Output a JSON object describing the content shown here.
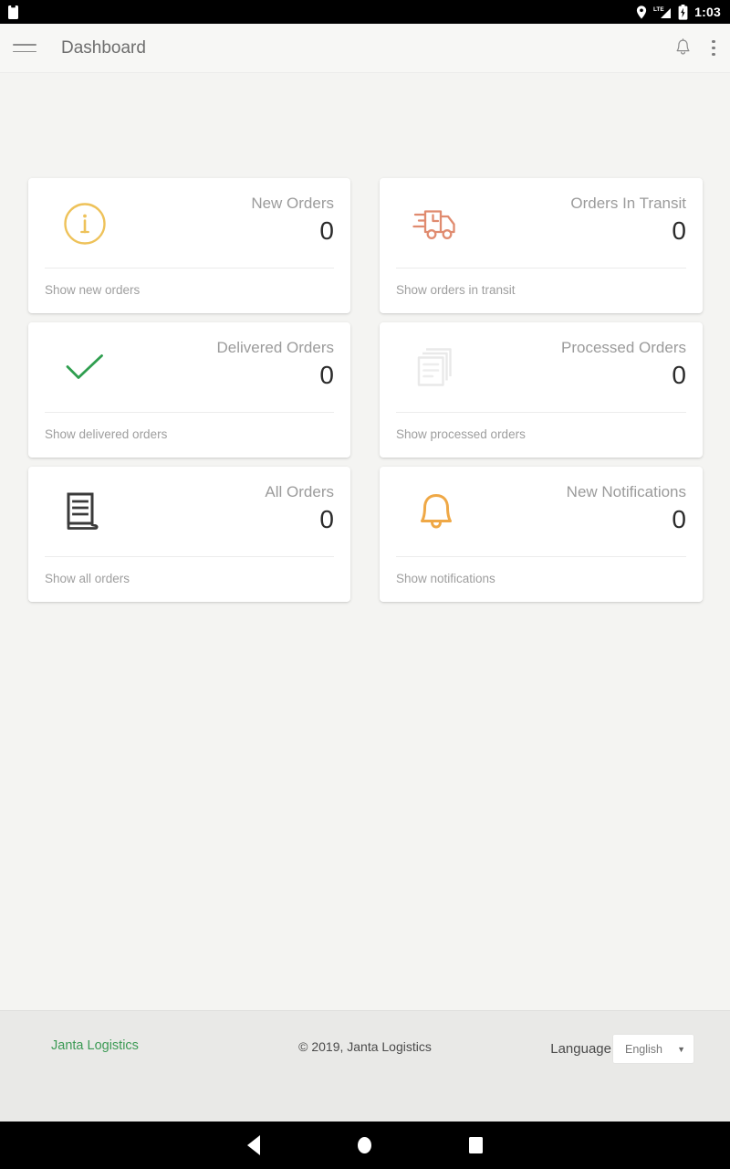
{
  "status_bar": {
    "time": "1:03",
    "network_label": "LTE",
    "icons": [
      "sim-card-icon",
      "location-pin-icon",
      "lte-signal-icon",
      "battery-charging-icon"
    ]
  },
  "app_bar": {
    "menu_icon": "hamburger-menu-icon",
    "title": "Dashboard",
    "notification_icon": "bell-icon",
    "overflow_icon": "more-vertical-icon"
  },
  "cards": [
    {
      "icon": "info-circle-icon",
      "icon_color": "#eec25a",
      "title": "New Orders",
      "value": "0",
      "link": "Show new orders"
    },
    {
      "icon": "delivery-truck-icon",
      "icon_color": "#e08b6f",
      "title": "Orders In Transit",
      "value": "0",
      "link": "Show orders in transit"
    },
    {
      "icon": "check-mark-icon",
      "icon_color": "#2f9e4f",
      "title": "Delivered Orders",
      "value": "0",
      "link": "Show delivered orders"
    },
    {
      "icon": "documents-stack-icon",
      "icon_color": "#eaeaea",
      "title": "Processed Orders",
      "value": "0",
      "link": "Show processed orders"
    },
    {
      "icon": "invoice-document-icon",
      "icon_color": "#3a3a3a",
      "title": "All Orders",
      "value": "0",
      "link": "Show all orders"
    },
    {
      "icon": "bell-outline-icon",
      "icon_color": "#efa846",
      "title": "New Notifications",
      "value": "0",
      "link": "Show notifications"
    }
  ],
  "footer": {
    "brand": "Janta Logistics",
    "brand_color": "#3c9a55",
    "copyright": "© 2019, Janta Logistics",
    "language_label": "Language",
    "language_value": "English",
    "caret": "▼"
  },
  "nav_bar": {
    "back": "back-button",
    "home": "home-button",
    "recents": "recents-button"
  },
  "theme": {
    "page_background": "#f4f4f2",
    "card_background": "#ffffff",
    "footer_background": "#e9e9e7"
  }
}
